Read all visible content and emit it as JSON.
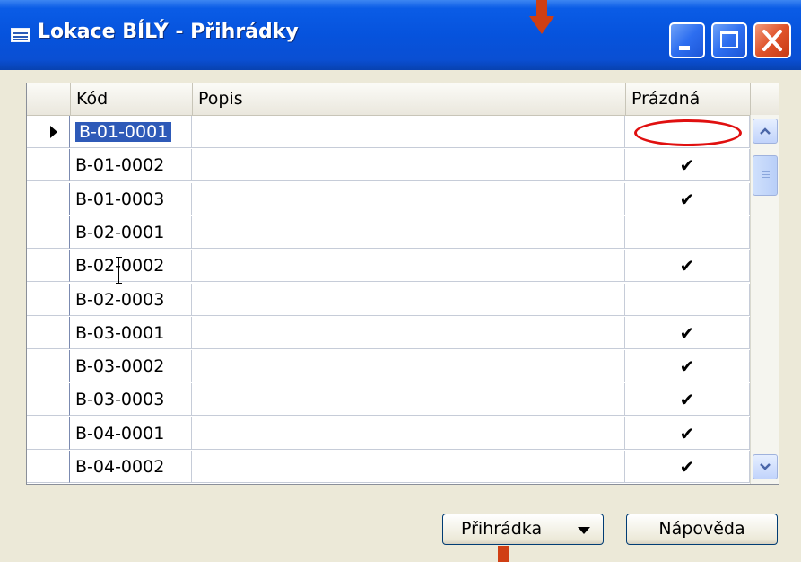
{
  "window": {
    "title": "Lokace BÍLÝ - Přihrádky"
  },
  "table": {
    "columns": [
      "Kód",
      "Popis",
      "Prázdná"
    ],
    "rows": [
      {
        "code": "B-01-0001",
        "popis": "",
        "empty": ""
      },
      {
        "code": "B-01-0002",
        "popis": "",
        "empty": "✔"
      },
      {
        "code": "B-01-0003",
        "popis": "",
        "empty": "✔"
      },
      {
        "code": "B-02-0001",
        "popis": "",
        "empty": ""
      },
      {
        "code": "B-02-0002",
        "popis": "",
        "empty": "✔"
      },
      {
        "code": "B-02-0003",
        "popis": "",
        "empty": ""
      },
      {
        "code": "B-03-0001",
        "popis": "",
        "empty": "✔"
      },
      {
        "code": "B-03-0002",
        "popis": "",
        "empty": "✔"
      },
      {
        "code": "B-03-0003",
        "popis": "",
        "empty": "✔"
      },
      {
        "code": "B-04-0001",
        "popis": "",
        "empty": "✔"
      },
      {
        "code": "B-04-0002",
        "popis": "",
        "empty": "✔"
      }
    ],
    "selected_row": 0
  },
  "buttons": {
    "prihradka": "Přihrádka",
    "napoveda": "Nápověda"
  },
  "colors": {
    "title_bar": "#0653dd",
    "selection": "#2e5ab8",
    "annotation": "#d03f14",
    "highlight": "#e01010"
  },
  "icons": {
    "window": "table-icon",
    "minimize": "minimize-icon",
    "maximize": "maximize-icon",
    "close": "close-icon",
    "row_pointer": "triangle-right-icon",
    "check": "checkmark-icon",
    "scroll_up": "chevron-up-icon",
    "scroll_down": "chevron-down-icon"
  }
}
